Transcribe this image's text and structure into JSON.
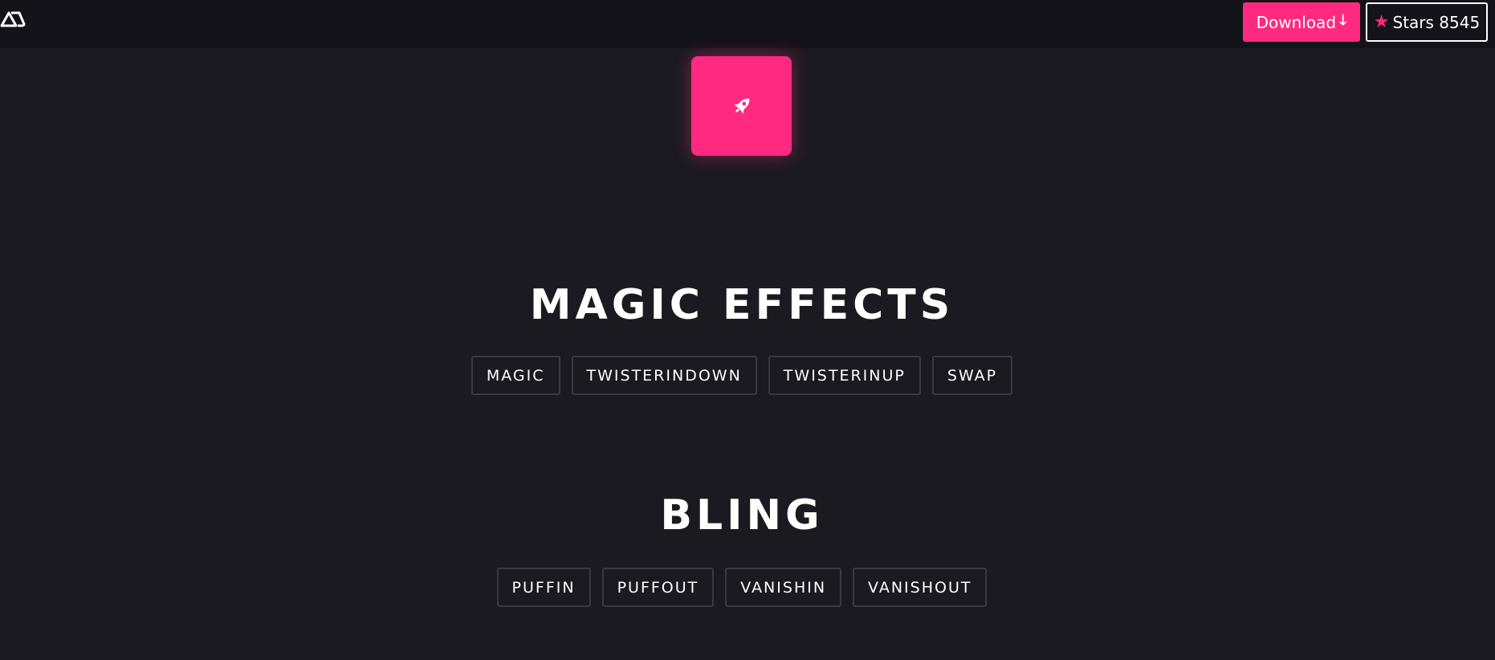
{
  "header": {
    "logo_icon": "logo-icon",
    "download_label": "Download",
    "download_icon": "arrow-down-icon",
    "download_arrow": "🡓",
    "stars_icon": "star-icon",
    "stars_star": "★",
    "stars_label": "Stars 8545",
    "accent_color": "#ff2a7f"
  },
  "hero": {
    "icon": "rocket-icon"
  },
  "sections": [
    {
      "title": "MAGIC EFFECTS",
      "buttons": [
        "MAGIC",
        "TWISTERINDOWN",
        "TWISTERINUP",
        "SWAP"
      ]
    },
    {
      "title": "BLING",
      "buttons": [
        "PUFFIN",
        "PUFFOUT",
        "VANISHIN",
        "VANISHOUT"
      ]
    }
  ]
}
